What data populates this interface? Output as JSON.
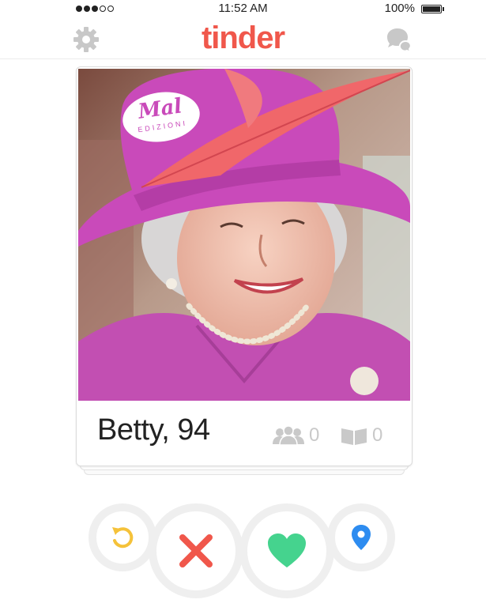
{
  "status_bar": {
    "time": "11:52 AM",
    "battery": "100%"
  },
  "nav": {
    "logo": "tinder",
    "settings_icon": "gear-icon",
    "messages_icon": "chat-bubbles-icon"
  },
  "card": {
    "photo": {
      "description_icon": "profile-photo",
      "watermark_line1": "Mal",
      "watermark_line2": "EDIZIONI"
    },
    "name_age": "Betty, 94",
    "friends_count": "0",
    "interests_count": "0"
  },
  "actions": {
    "rewind_icon": "rewind-icon",
    "nope_icon": "close-icon",
    "like_icon": "heart-icon",
    "location_icon": "location-pin-icon"
  },
  "colors": {
    "brand": "#f0574b",
    "rewind": "#f5c23a",
    "nope": "#f0574b",
    "like": "#45d38e",
    "location": "#2d8cf0"
  }
}
